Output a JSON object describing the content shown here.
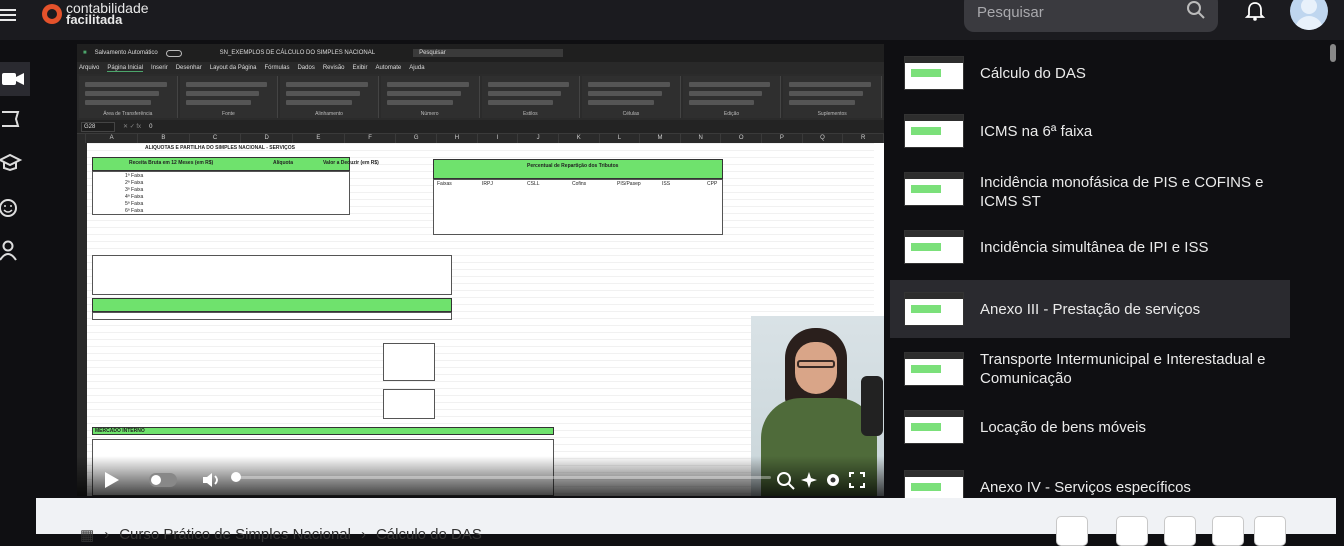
{
  "header": {
    "logo_line1": "contabilidade",
    "logo_line2": "facilitada",
    "search_placeholder": "Pesquisar"
  },
  "video": {
    "excel_title": "SN_EXEMPLOS DE CÁLCULO DO SIMPLES NACIONAL",
    "autosave": "Salvamento Automático",
    "excel_search": "Pesquisar",
    "menu": [
      "Arquivo",
      "Página Inicial",
      "Inserir",
      "Desenhar",
      "Layout da Página",
      "Fórmulas",
      "Dados",
      "Revisão",
      "Exibir",
      "Automate",
      "Ajuda"
    ],
    "ribbon_groups": [
      "Área de Transferência",
      "Fonte",
      "Alinhamento",
      "Número",
      "Estilos",
      "Células",
      "Edição",
      "Suplementos"
    ],
    "cell_ref": "G28",
    "formula_value": "0",
    "columns": [
      "A",
      "B",
      "C",
      "D",
      "E",
      "F",
      "G",
      "H",
      "I",
      "J",
      "K",
      "L",
      "M",
      "N",
      "O",
      "P",
      "Q",
      "R"
    ],
    "sheet_title": "ALIQUOTAS E PARTILHA DO SIMPLES NACIONAL - SERVIÇOS",
    "left_table_headers": [
      "Receita Bruta em 12 Meses (em R$)",
      "Alíquota",
      "Valor a Deduzir (em R$)"
    ],
    "faixas": [
      "1ª Faixa",
      "2ª Faixa",
      "3ª Faixa",
      "4ª Faixa",
      "5ª Faixa",
      "6ª Faixa"
    ],
    "right_table_header": "Percentual de Repartição dos Tributos",
    "right_table_cols": [
      "Faixas",
      "IRPJ",
      "CSLL",
      "Cofins",
      "PIS/Pasep",
      "ISS",
      "CPP"
    ],
    "mercado_interno": "MERCADO INTERNO",
    "progress_percent": 0.6
  },
  "playlist": [
    {
      "title": "Cálculo do DAS",
      "active": false
    },
    {
      "title": "ICMS na 6ª faixa",
      "active": false
    },
    {
      "title": "Incidência monofásica de PIS e COFINS e ICMS ST",
      "active": false
    },
    {
      "title": "Incidência simultânea de IPI e ISS",
      "active": false
    },
    {
      "title": "Anexo III - Prestação de serviços",
      "active": true
    },
    {
      "title": "Transporte Intermunicipal e Interestadual e Comunicação",
      "active": false
    },
    {
      "title": "Locação de bens móveis",
      "active": false
    },
    {
      "title": "Anexo IV - Serviços específicos",
      "active": false
    }
  ],
  "breadcrumb": {
    "course": "Curso Prático de Simples Nacional",
    "lesson": "Cálculo do DAS"
  }
}
